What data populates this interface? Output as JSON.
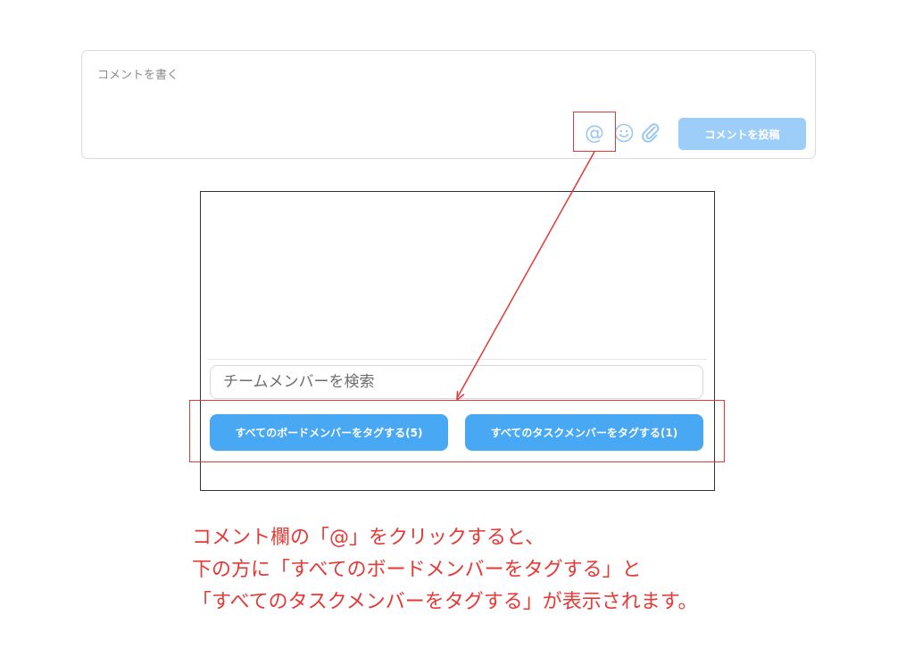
{
  "comment": {
    "placeholder": "コメントを書く",
    "post_button": "コメントを投稿",
    "icons": [
      "at-icon",
      "smile-icon",
      "paperclip-icon"
    ],
    "at_symbol": "@",
    "accent_color": "#9dcdf9"
  },
  "popup": {
    "search_placeholder": "チームメンバーを検索",
    "tag_all_board_label": "すべてのボードメンバーをタグする(5)",
    "tag_all_task_label": "すべてのタスクメンバーをタグする(1)",
    "button_color": "#48a8f3"
  },
  "annotation": {
    "color": "#e53935",
    "lines": [
      "コメント欄の「@」をクリックすると、",
      "下の方に「すべてのボードメンバーをタグする」と",
      "「すべてのタスクメンバーをタグする」が表示されます。"
    ]
  }
}
